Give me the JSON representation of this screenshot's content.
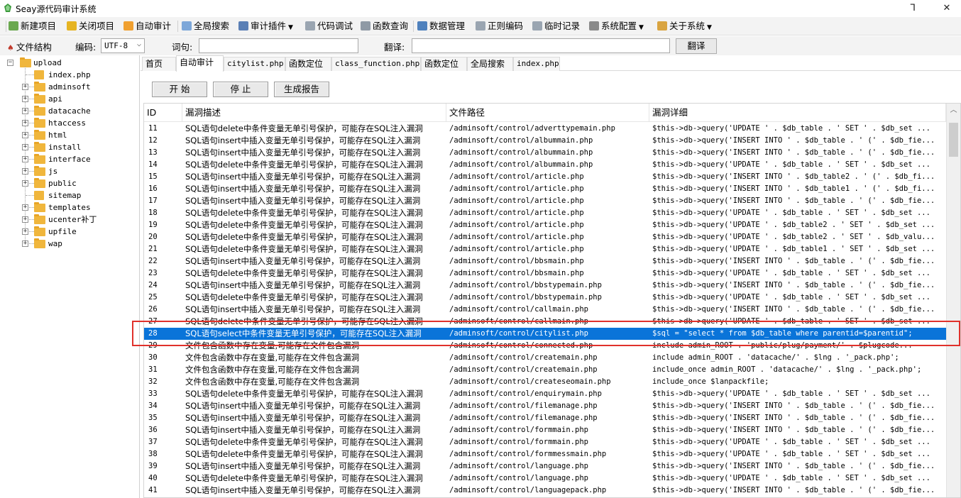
{
  "window": {
    "title": "Seay源代码审计系统",
    "minimize_glyph": "ᒣ",
    "close_glyph": "✕"
  },
  "menu": [
    {
      "label": "新建项目",
      "icon": "new-project-icon",
      "color": "#6aa84f",
      "dropdown": false
    },
    {
      "label": "关闭项目",
      "icon": "close-project-icon",
      "color": "#e6b422",
      "dropdown": false
    },
    {
      "label": "自动审计",
      "icon": "auto-audit-icon",
      "color": "#f0a030",
      "dropdown": false
    },
    {
      "label": "全局搜索",
      "icon": "global-search-icon",
      "color": "#7da7d9",
      "dropdown": false
    },
    {
      "label": "审计插件",
      "icon": "audit-plugin-icon",
      "color": "#5a7fb5",
      "dropdown": true
    },
    {
      "label": "代码调试",
      "icon": "code-debug-icon",
      "color": "#9aa5b1",
      "dropdown": false
    },
    {
      "label": "函数查询",
      "icon": "function-query-icon",
      "color": "#8f9aa5",
      "dropdown": false
    },
    {
      "label": "数据管理",
      "icon": "data-manage-icon",
      "color": "#4f81bd",
      "dropdown": false
    },
    {
      "label": "正则编码",
      "icon": "regex-encode-icon",
      "color": "#9aa5b1",
      "dropdown": false
    },
    {
      "label": "临时记录",
      "icon": "temp-record-icon",
      "color": "#9aa5b1",
      "dropdown": false
    },
    {
      "label": "系统配置",
      "icon": "system-config-icon",
      "color": "#8a8a8a",
      "dropdown": true
    },
    {
      "label": "关于系统",
      "icon": "about-system-icon",
      "color": "#d9a441",
      "dropdown": true
    }
  ],
  "toolbar": {
    "file_structure_label": "文件结构",
    "encoding_label": "编码:",
    "encoding_value": "UTF-8",
    "term_label": "词句:",
    "term_value": "",
    "translate_label": "翻译:",
    "translate_value": "",
    "translate_button": "翻译"
  },
  "tree": {
    "root": "upload",
    "items": [
      {
        "label": "index.php",
        "type": "file"
      },
      {
        "label": "adminsoft",
        "type": "folder"
      },
      {
        "label": "api",
        "type": "folder"
      },
      {
        "label": "datacache",
        "type": "folder"
      },
      {
        "label": "htaccess",
        "type": "folder"
      },
      {
        "label": "html",
        "type": "folder"
      },
      {
        "label": "install",
        "type": "folder"
      },
      {
        "label": "interface",
        "type": "folder"
      },
      {
        "label": "js",
        "type": "folder"
      },
      {
        "label": "public",
        "type": "folder"
      },
      {
        "label": "sitemap",
        "type": "file"
      },
      {
        "label": "templates",
        "type": "folder"
      },
      {
        "label": "ucenter补丁",
        "type": "folder"
      },
      {
        "label": "upfile",
        "type": "folder"
      },
      {
        "label": "wap",
        "type": "folder"
      }
    ]
  },
  "tabs": [
    {
      "label": "首页",
      "mono": false,
      "active": false
    },
    {
      "label": "自动审计",
      "mono": false,
      "active": true
    },
    {
      "label": "citylist.php",
      "mono": true,
      "active": false
    },
    {
      "label": "函数定位",
      "mono": false,
      "active": false
    },
    {
      "label": "class_function.php",
      "mono": true,
      "active": false
    },
    {
      "label": "函数定位",
      "mono": false,
      "active": false
    },
    {
      "label": "全局搜索",
      "mono": false,
      "active": false
    },
    {
      "label": "index.php",
      "mono": true,
      "active": false
    }
  ],
  "controls": {
    "start": "开 始",
    "stop": "停 止",
    "report": "生成报告"
  },
  "table": {
    "columns": [
      "ID",
      "漏洞描述",
      "文件路径",
      "漏洞详细"
    ],
    "selected_id": "28",
    "rows": [
      {
        "id": "11",
        "desc": "SQL语句delete中条件变量无单引号保护，可能存在SQL注入漏洞",
        "path": "/adminsoft/control/adverttypemain.php",
        "detail": "$this->db->query('UPDATE ' . $db_table . ' SET ' . $db_set ..."
      },
      {
        "id": "12",
        "desc": "SQL语句insert中插入变量无单引号保护，可能存在SQL注入漏洞",
        "path": "/adminsoft/control/albummain.php",
        "detail": "$this->db->query('INSERT INTO ' . $db_table . ' (' . $db_fie..."
      },
      {
        "id": "13",
        "desc": "SQL语句insert中插入变量无单引号保护，可能存在SQL注入漏洞",
        "path": "/adminsoft/control/albummain.php",
        "detail": "$this->db->query('INSERT INTO ' . $db_table . ' (' . $db_fie..."
      },
      {
        "id": "14",
        "desc": "SQL语句delete中条件变量无单引号保护，可能存在SQL注入漏洞",
        "path": "/adminsoft/control/albummain.php",
        "detail": "$this->db->query('UPDATE ' . $db_table . ' SET ' . $db_set ..."
      },
      {
        "id": "15",
        "desc": "SQL语句insert中插入变量无单引号保护，可能存在SQL注入漏洞",
        "path": "/adminsoft/control/article.php",
        "detail": "$this->db->query('INSERT INTO ' . $db_table2 . ' (' . $db_fi..."
      },
      {
        "id": "16",
        "desc": "SQL语句insert中插入变量无单引号保护，可能存在SQL注入漏洞",
        "path": "/adminsoft/control/article.php",
        "detail": "$this->db->query('INSERT INTO ' . $db_table1 . ' (' . $db_fi..."
      },
      {
        "id": "17",
        "desc": "SQL语句insert中插入变量无单引号保护，可能存在SQL注入漏洞",
        "path": "/adminsoft/control/article.php",
        "detail": "$this->db->query('INSERT INTO ' . $db_table . ' (' . $db_fie..."
      },
      {
        "id": "18",
        "desc": "SQL语句delete中条件变量无单引号保护，可能存在SQL注入漏洞",
        "path": "/adminsoft/control/article.php",
        "detail": "$this->db->query('UPDATE ' . $db_table . ' SET ' . $db_set ..."
      },
      {
        "id": "19",
        "desc": "SQL语句delete中条件变量无单引号保护，可能存在SQL注入漏洞",
        "path": "/adminsoft/control/article.php",
        "detail": "$this->db->query('UPDATE ' . $db_table2 . ' SET ' . $db_set ..."
      },
      {
        "id": "20",
        "desc": "SQL语句delete中条件变量无单引号保护，可能存在SQL注入漏洞",
        "path": "/adminsoft/control/article.php",
        "detail": "$this->db->query('UPDATE ' . $db_table2 . ' SET ' . $db_valu..."
      },
      {
        "id": "21",
        "desc": "SQL语句delete中条件变量无单引号保护，可能存在SQL注入漏洞",
        "path": "/adminsoft/control/article.php",
        "detail": "$this->db->query('UPDATE ' . $db_table1 . ' SET ' . $db_set ..."
      },
      {
        "id": "22",
        "desc": "SQL语句insert中插入变量无单引号保护，可能存在SQL注入漏洞",
        "path": "/adminsoft/control/bbsmain.php",
        "detail": "$this->db->query('INSERT INTO ' . $db_table . ' (' . $db_fie..."
      },
      {
        "id": "23",
        "desc": "SQL语句delete中条件变量无单引号保护，可能存在SQL注入漏洞",
        "path": "/adminsoft/control/bbsmain.php",
        "detail": "$this->db->query('UPDATE ' . $db_table . ' SET ' . $db_set ..."
      },
      {
        "id": "24",
        "desc": "SQL语句insert中插入变量无单引号保护，可能存在SQL注入漏洞",
        "path": "/adminsoft/control/bbstypemain.php",
        "detail": "$this->db->query('INSERT INTO ' . $db_table . ' (' . $db_fie..."
      },
      {
        "id": "25",
        "desc": "SQL语句delete中条件变量无单引号保护，可能存在SQL注入漏洞",
        "path": "/adminsoft/control/bbstypemain.php",
        "detail": "$this->db->query('UPDATE ' . $db_table . ' SET ' . $db_set ..."
      },
      {
        "id": "26",
        "desc": "SQL语句insert中插入变量无单引号保护，可能存在SQL注入漏洞",
        "path": "/adminsoft/control/callmain.php",
        "detail": "$this->db->query('INSERT INTO ' . $db_table . ' (' . $db_fie..."
      },
      {
        "id": "27",
        "desc": "SQL语句delete中条件变量无单引号保护，可能存在SQL注入漏洞",
        "path": "/adminsoft/control/callmain.php",
        "detail": "$this->db->query('UPDATE ' . $db_table . ' SET ' . $db_set ..."
      },
      {
        "id": "28",
        "desc": "SQL语句select中条件变量无单引号保护，可能存在SQL注入漏洞",
        "path": "/adminsoft/control/citylist.php",
        "detail": "$sql = \"select * from $db_table where parentid=$parentid\";"
      },
      {
        "id": "29",
        "desc": "文件包含函数中存在变量,可能存在文件包含漏洞",
        "path": "/adminsoft/control/connected.php",
        "detail": "include admin_ROOT . 'public/plug/payment/' . $plugcode..."
      },
      {
        "id": "30",
        "desc": "文件包含函数中存在变量,可能存在文件包含漏洞",
        "path": "/adminsoft/control/createmain.php",
        "detail": "include admin_ROOT . 'datacache/' . $lng . '_pack.php';"
      },
      {
        "id": "31",
        "desc": "文件包含函数中存在变量,可能存在文件包含漏洞",
        "path": "/adminsoft/control/createmain.php",
        "detail": "include_once admin_ROOT . 'datacache/' . $lng . '_pack.php';"
      },
      {
        "id": "32",
        "desc": "文件包含函数中存在变量,可能存在文件包含漏洞",
        "path": "/adminsoft/control/createseomain.php",
        "detail": "include_once $lanpackfile;"
      },
      {
        "id": "33",
        "desc": "SQL语句delete中条件变量无单引号保护，可能存在SQL注入漏洞",
        "path": "/adminsoft/control/enquirymain.php",
        "detail": "$this->db->query('UPDATE ' . $db_table . ' SET ' . $db_set ..."
      },
      {
        "id": "34",
        "desc": "SQL语句insert中插入变量无单引号保护，可能存在SQL注入漏洞",
        "path": "/adminsoft/control/filemanage.php",
        "detail": "$this->db->query('INSERT INTO ' . $db_table . ' (' . $db_fie..."
      },
      {
        "id": "35",
        "desc": "SQL语句insert中插入变量无单引号保护，可能存在SQL注入漏洞",
        "path": "/adminsoft/control/filemanage.php",
        "detail": "$this->db->query('INSERT INTO ' . $db_table . ' (' . $db_fie..."
      },
      {
        "id": "36",
        "desc": "SQL语句insert中插入变量无单引号保护，可能存在SQL注入漏洞",
        "path": "/adminsoft/control/formmain.php",
        "detail": "$this->db->query('INSERT INTO ' . $db_table . ' (' . $db_fie..."
      },
      {
        "id": "37",
        "desc": "SQL语句delete中条件变量无单引号保护，可能存在SQL注入漏洞",
        "path": "/adminsoft/control/formmain.php",
        "detail": "$this->db->query('UPDATE ' . $db_table . ' SET ' . $db_set ..."
      },
      {
        "id": "38",
        "desc": "SQL语句delete中条件变量无单引号保护，可能存在SQL注入漏洞",
        "path": "/adminsoft/control/formmessmain.php",
        "detail": "$this->db->query('UPDATE ' . $db_table . ' SET ' . $db_set ..."
      },
      {
        "id": "39",
        "desc": "SQL语句insert中插入变量无单引号保护，可能存在SQL注入漏洞",
        "path": "/adminsoft/control/language.php",
        "detail": "$this->db->query('INSERT INTO ' . $db_table . ' (' . $db_fie..."
      },
      {
        "id": "40",
        "desc": "SQL语句delete中条件变量无单引号保护，可能存在SQL注入漏洞",
        "path": "/adminsoft/control/language.php",
        "detail": "$this->db->query('UPDATE ' . $db_table . ' SET ' . $db_set ..."
      },
      {
        "id": "41",
        "desc": "SQL语句insert中插入变量无单引号保护，可能存在SQL注入漏洞",
        "path": "/adminsoft/control/languagepack.php",
        "detail": "$this->db->query('INSERT INTO ' . $db_table . ' (' . $db_fie..."
      }
    ]
  }
}
